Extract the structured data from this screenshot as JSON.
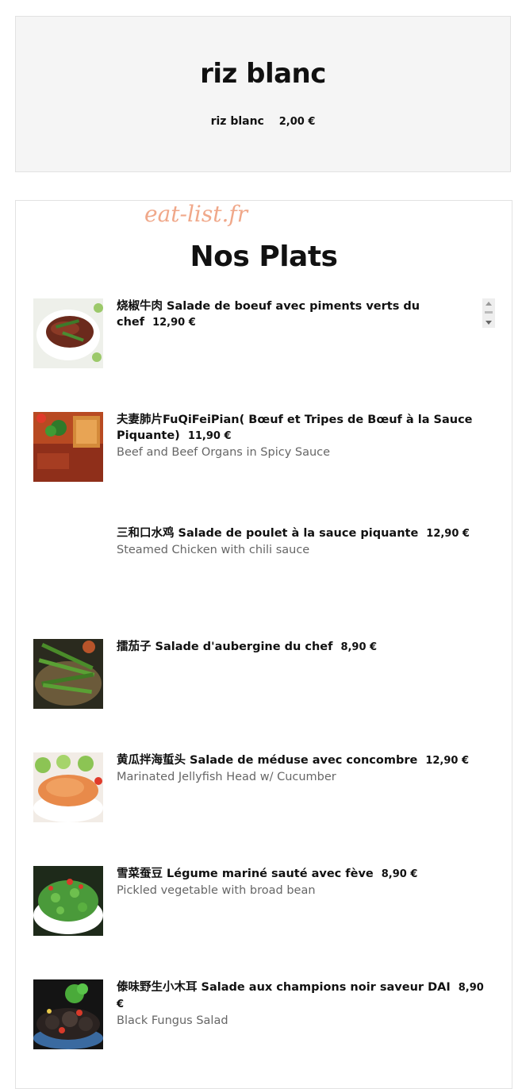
{
  "top_card": {
    "title": "riz blanc",
    "item_name": "riz blanc",
    "item_price": "2,00 €"
  },
  "watermark": "eat-list.fr",
  "section_title": "Nos Plats",
  "items": [
    {
      "name": "烧椒牛肉 Salade de boeuf avec piments verts du chef",
      "price": "12,90 €",
      "desc": ""
    },
    {
      "name": "夫妻肺片FuQiFeiPian( Bœuf et Tripes de Bœuf à la Sauce Piquante)",
      "price": "11,90 €",
      "desc": "Beef and Beef Organs in Spicy Sauce"
    },
    {
      "name": "三和口水鸡 Salade de poulet à la sauce piquante",
      "price": "12,90 €",
      "desc": "Steamed Chicken with chili sauce"
    },
    {
      "name": "擂茄子 Salade d'aubergine du chef",
      "price": "8,90 €",
      "desc": ""
    },
    {
      "name": "黄瓜拌海蜇头 Salade de méduse avec concombre",
      "price": "12,90 €",
      "desc": "Marinated Jellyfish Head w/ Cucumber"
    },
    {
      "name": "雪菜蚕豆 Légume mariné sauté avec fève",
      "price": "8,90 €",
      "desc": "Pickled vegetable with broad bean"
    },
    {
      "name": "傣味野生小木耳 Salade aux champions noir saveur DAI",
      "price": "8,90 €",
      "desc": "Black Fungus Salad"
    }
  ]
}
